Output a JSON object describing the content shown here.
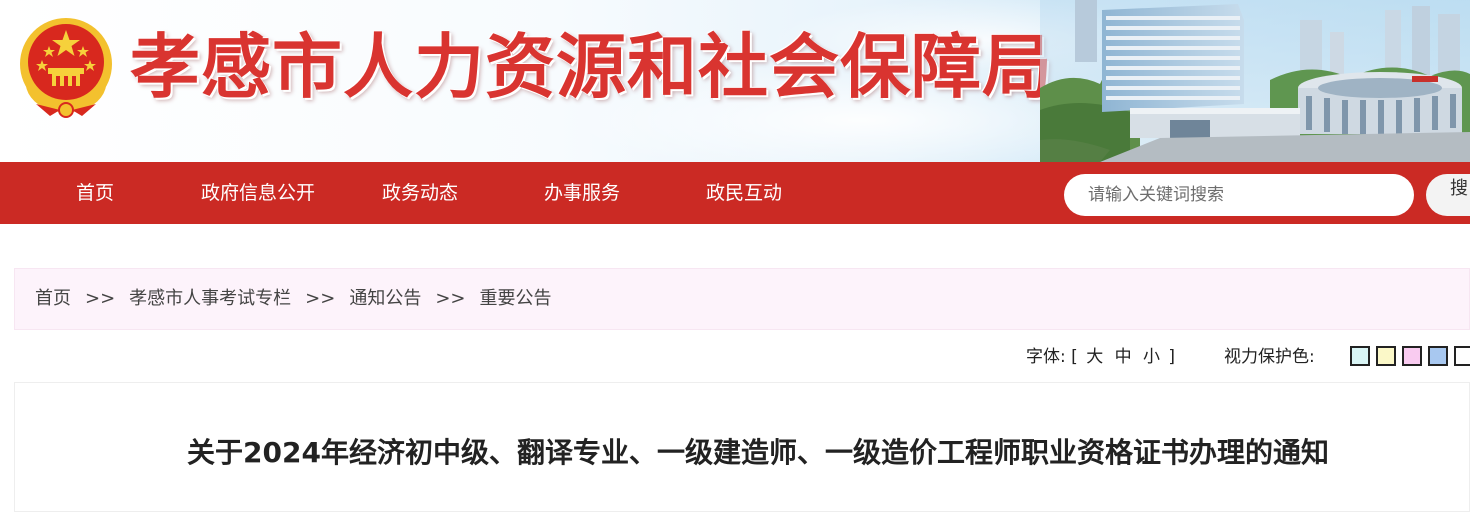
{
  "header": {
    "site_title": "孝感市人力资源和社会保障局"
  },
  "nav": {
    "items": [
      {
        "label": "首页"
      },
      {
        "label": "政府信息公开"
      },
      {
        "label": "政务动态"
      },
      {
        "label": "办事服务"
      },
      {
        "label": "政民互动"
      }
    ],
    "search": {
      "placeholder": "请输入关键词搜索",
      "button_label": "搜"
    }
  },
  "breadcrumb": {
    "items": [
      "首页",
      "孝感市人事考试专栏",
      "通知公告",
      "重要公告"
    ],
    "separator": ">>"
  },
  "tools": {
    "font_label": "字体:",
    "bracket_open": "[",
    "bracket_close": "]",
    "sizes": [
      "大",
      "中",
      "小"
    ],
    "eye_label": "视力保护色:",
    "eye_colors": [
      "#d9f5f5",
      "#fbf8c8",
      "#f9cbf0",
      "#a8c8f0",
      "#ffffff"
    ]
  },
  "article": {
    "title": "关于2024年经济初中级、翻译专业、一级建造师、一级造价工程师职业资格证书办理的通知"
  },
  "colors": {
    "brand_red": "#cb2a24",
    "title_red": "#d93430",
    "breadcrumb_bg": "#fdf3fb"
  }
}
